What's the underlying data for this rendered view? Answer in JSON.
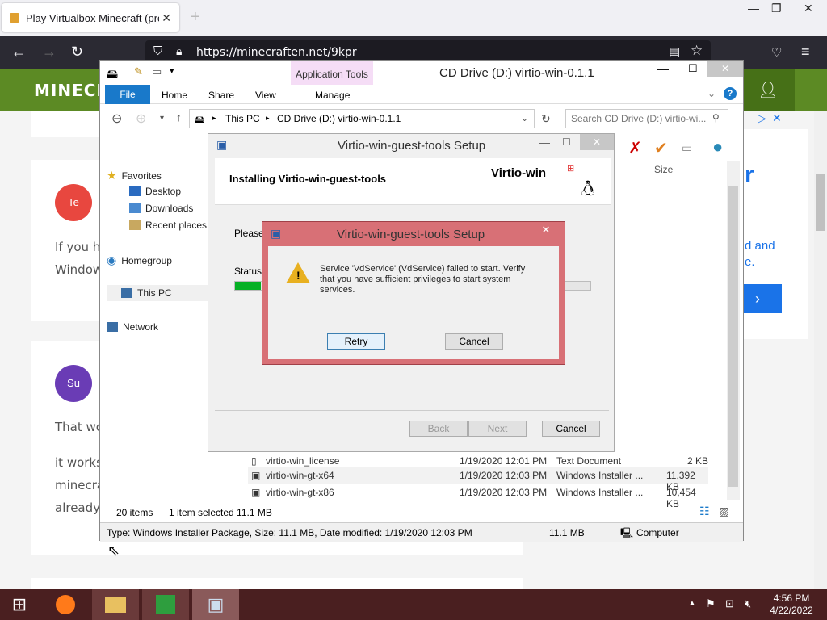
{
  "browser": {
    "tab_title": "Play Virtualbox Minecraft (probl",
    "tab_close": "✕",
    "new_tab": "+",
    "url": "https://minecraften.net/9kpr",
    "window_controls": [
      "—",
      "❐",
      "✕"
    ]
  },
  "site": {
    "logo": "MINECR",
    "comments": [
      {
        "avatar": "Te",
        "avatar_color": "#e8473f",
        "lines": [
          "If you h",
          "Window"
        ]
      },
      {
        "avatar": "Su",
        "avatar_color": "#6a3cb5",
        "lines": [
          "That wo",
          "it works",
          "minecra",
          "already"
        ]
      }
    ],
    "ad": {
      "letter": "r",
      "text1": "d and",
      "text2": "e."
    }
  },
  "explorer": {
    "title": "CD Drive (D:) virtio-win-0.1.1",
    "app_tools": "Application Tools",
    "ribbon_tabs": [
      "File",
      "Home",
      "Share",
      "View",
      "Manage"
    ],
    "breadcrumb": [
      "This PC",
      "CD Drive (D:) virtio-win-0.1.1"
    ],
    "search_placeholder": "Search CD Drive (D:) virtio-wi...",
    "nav": {
      "favorites": "Favorites",
      "desktop": "Desktop",
      "downloads": "Downloads",
      "recent": "Recent places",
      "homegroup": "Homegroup",
      "thispc": "This PC",
      "network": "Network"
    },
    "size_header": "Size",
    "files": [
      {
        "name": "virtio-win_license",
        "date": "1/19/2020 12:01 PM",
        "type": "Text Document",
        "size": "2 KB"
      },
      {
        "name": "virtio-win-gt-x64",
        "date": "1/19/2020 12:03 PM",
        "type": "Windows Installer ...",
        "size": "11,392 KB"
      },
      {
        "name": "virtio-win-gt-x86",
        "date": "1/19/2020 12:03 PM",
        "type": "Windows Installer ...",
        "size": "10,454 KB"
      }
    ],
    "item_count": "20 items",
    "selected": "1 item selected  11.1 MB",
    "status_detail": "Type: Windows Installer Package, Size: 11.1 MB, Date modified: 1/19/2020 12:03 PM",
    "status_size": "11.1 MB",
    "status_location": "Computer"
  },
  "setup": {
    "title": "Virtio-win-guest-tools Setup",
    "heading": "Installing Virtio-win-guest-tools",
    "logo": "Virtio-win",
    "please": "Please",
    "status": "Status:",
    "back": "Back",
    "next": "Next",
    "cancel": "Cancel"
  },
  "error": {
    "title": "Virtio-win-guest-tools Setup",
    "message": "Service 'VdService' (VdService) failed to start.  Verify that you have sufficient privileges to start system services.",
    "retry": "Retry",
    "cancel": "Cancel",
    "close": "✕"
  },
  "taskbar": {
    "time": "4:56 PM",
    "date": "4/22/2022"
  }
}
